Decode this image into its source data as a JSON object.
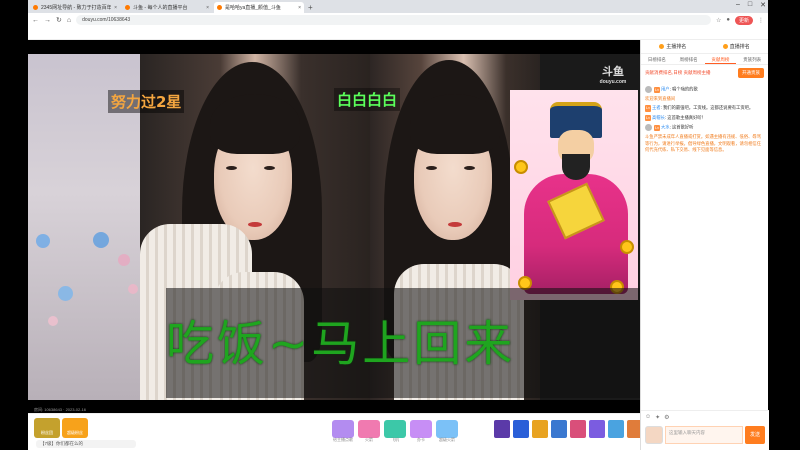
{
  "browser": {
    "tabs": [
      {
        "label": "2345网址导航 - 致力于打造百年",
        "active": false
      },
      {
        "label": "斗鱼 - 每个人的直播平台",
        "active": false
      },
      {
        "label": "是哈哈ya直播_颜值_斗鱼",
        "active": true
      }
    ],
    "new_tab": "+",
    "url": "douyu.com/10638643",
    "update_label": "更新"
  },
  "stream": {
    "overlay_left": "努力过2星",
    "overlay_right": "白白白白",
    "banner": "吃饭~马上回来",
    "logo_top": "斗鱼",
    "logo_bottom": "douyu.com",
    "info": "房间: 10638643 · 2023-02-16"
  },
  "bottombar": {
    "badges": [
      {
        "label": "粉丝团",
        "color": "#c4a12d"
      },
      {
        "label": "超级粉丝",
        "color": "#f7a21b"
      }
    ],
    "message": "【7级】你们都在么的",
    "gifts": [
      {
        "label": "给主播点歌",
        "color": "#b38cf0"
      },
      {
        "label": "火箭",
        "color": "#f07ab0"
      },
      {
        "label": "飞机",
        "color": "#3cc8a8"
      },
      {
        "label": "办卡",
        "color": "#c78ef5"
      },
      {
        "label": "超级火箭",
        "color": "#7bc1f7"
      }
    ],
    "ad_colors": [
      "#5b3aa8",
      "#2a5fd8",
      "#e8a321",
      "#3a78d0",
      "#d94f7a",
      "#7b5ce0",
      "#4aa3e0",
      "#e07c3a",
      "#b5862a",
      "#6a3bc2"
    ]
  },
  "panel": {
    "rank_left": "主播排名",
    "rank_right": "直播排名",
    "tabs": [
      "日榜排名",
      "周榜排名",
      "贡献周榜",
      "贵族列表"
    ],
    "notice": "贡献消费排名,日榜 贡献周榜主播",
    "open_label": "开通贵族",
    "messages": [
      {
        "type": "user",
        "name": "用户",
        "text": "唱个嗨的的歌"
      },
      {
        "type": "system",
        "text": "欢迎来到直播间"
      },
      {
        "type": "user",
        "name": "王者",
        "text": "我们的最强吧。工资线。这都还说要有工资吧。"
      },
      {
        "type": "user",
        "name": "高帽长",
        "text": "这首歌主播真好听！"
      },
      {
        "type": "user",
        "name": "大水",
        "text": "这首歌好听"
      },
      {
        "type": "system",
        "text": "斗鱼严禁未成年人直播或打赏。如遇主播有违规、低俗、辱骂等行为，请进行举报。倡导绿色直播，文明观看，请勿相信任何代充代练、私下交易、线下见面等信息。"
      }
    ],
    "input_placeholder": "这里输入聊天内容",
    "send_label": "发送"
  }
}
